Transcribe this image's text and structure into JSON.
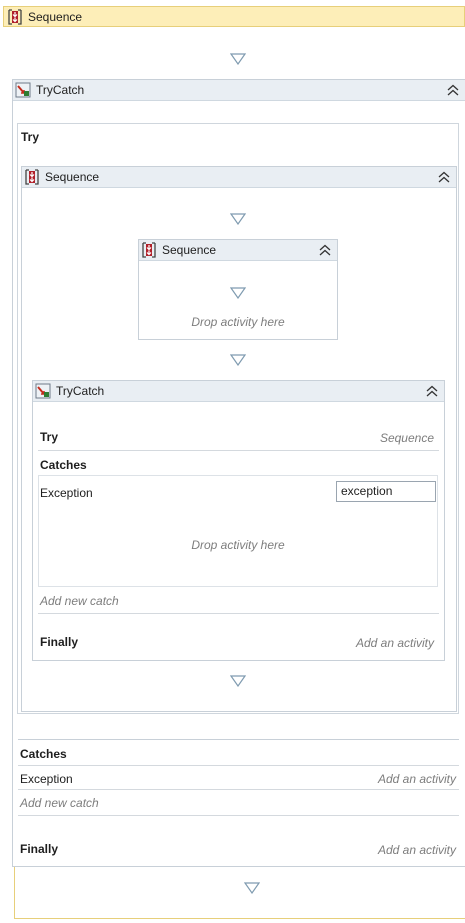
{
  "root": {
    "title": "Sequence"
  },
  "outer_trycatch": {
    "title": "TryCatch",
    "try_label": "Try",
    "catches_label": "Catches",
    "catch_exception_type": "Exception",
    "catch_placeholder": "Add an activity",
    "add_new_catch": "Add new catch",
    "finally_label": "Finally",
    "finally_placeholder": "Add an activity"
  },
  "try_sequence": {
    "title": "Sequence"
  },
  "nested_sequence": {
    "title": "Sequence",
    "drop_hint": "Drop activity here"
  },
  "inner_trycatch": {
    "title": "TryCatch",
    "try_label": "Try",
    "try_value": "Sequence",
    "catches_label": "Catches",
    "catch_exception_type": "Exception",
    "catch_variable": "exception",
    "drop_hint": "Drop activity here",
    "add_new_catch": "Add new catch",
    "finally_label": "Finally",
    "finally_placeholder": "Add an activity"
  },
  "colors": {
    "root_header": "#fdeeb8",
    "activity_header": "#e9eef3",
    "arrow": "#7f9bb0",
    "sequence_icon": "#b0202a"
  },
  "icons": {
    "sequence": "sequence-icon",
    "trycatch": "trycatch-icon",
    "collapse": "double-chevron-up-icon",
    "insert": "drop-arrow-icon"
  }
}
